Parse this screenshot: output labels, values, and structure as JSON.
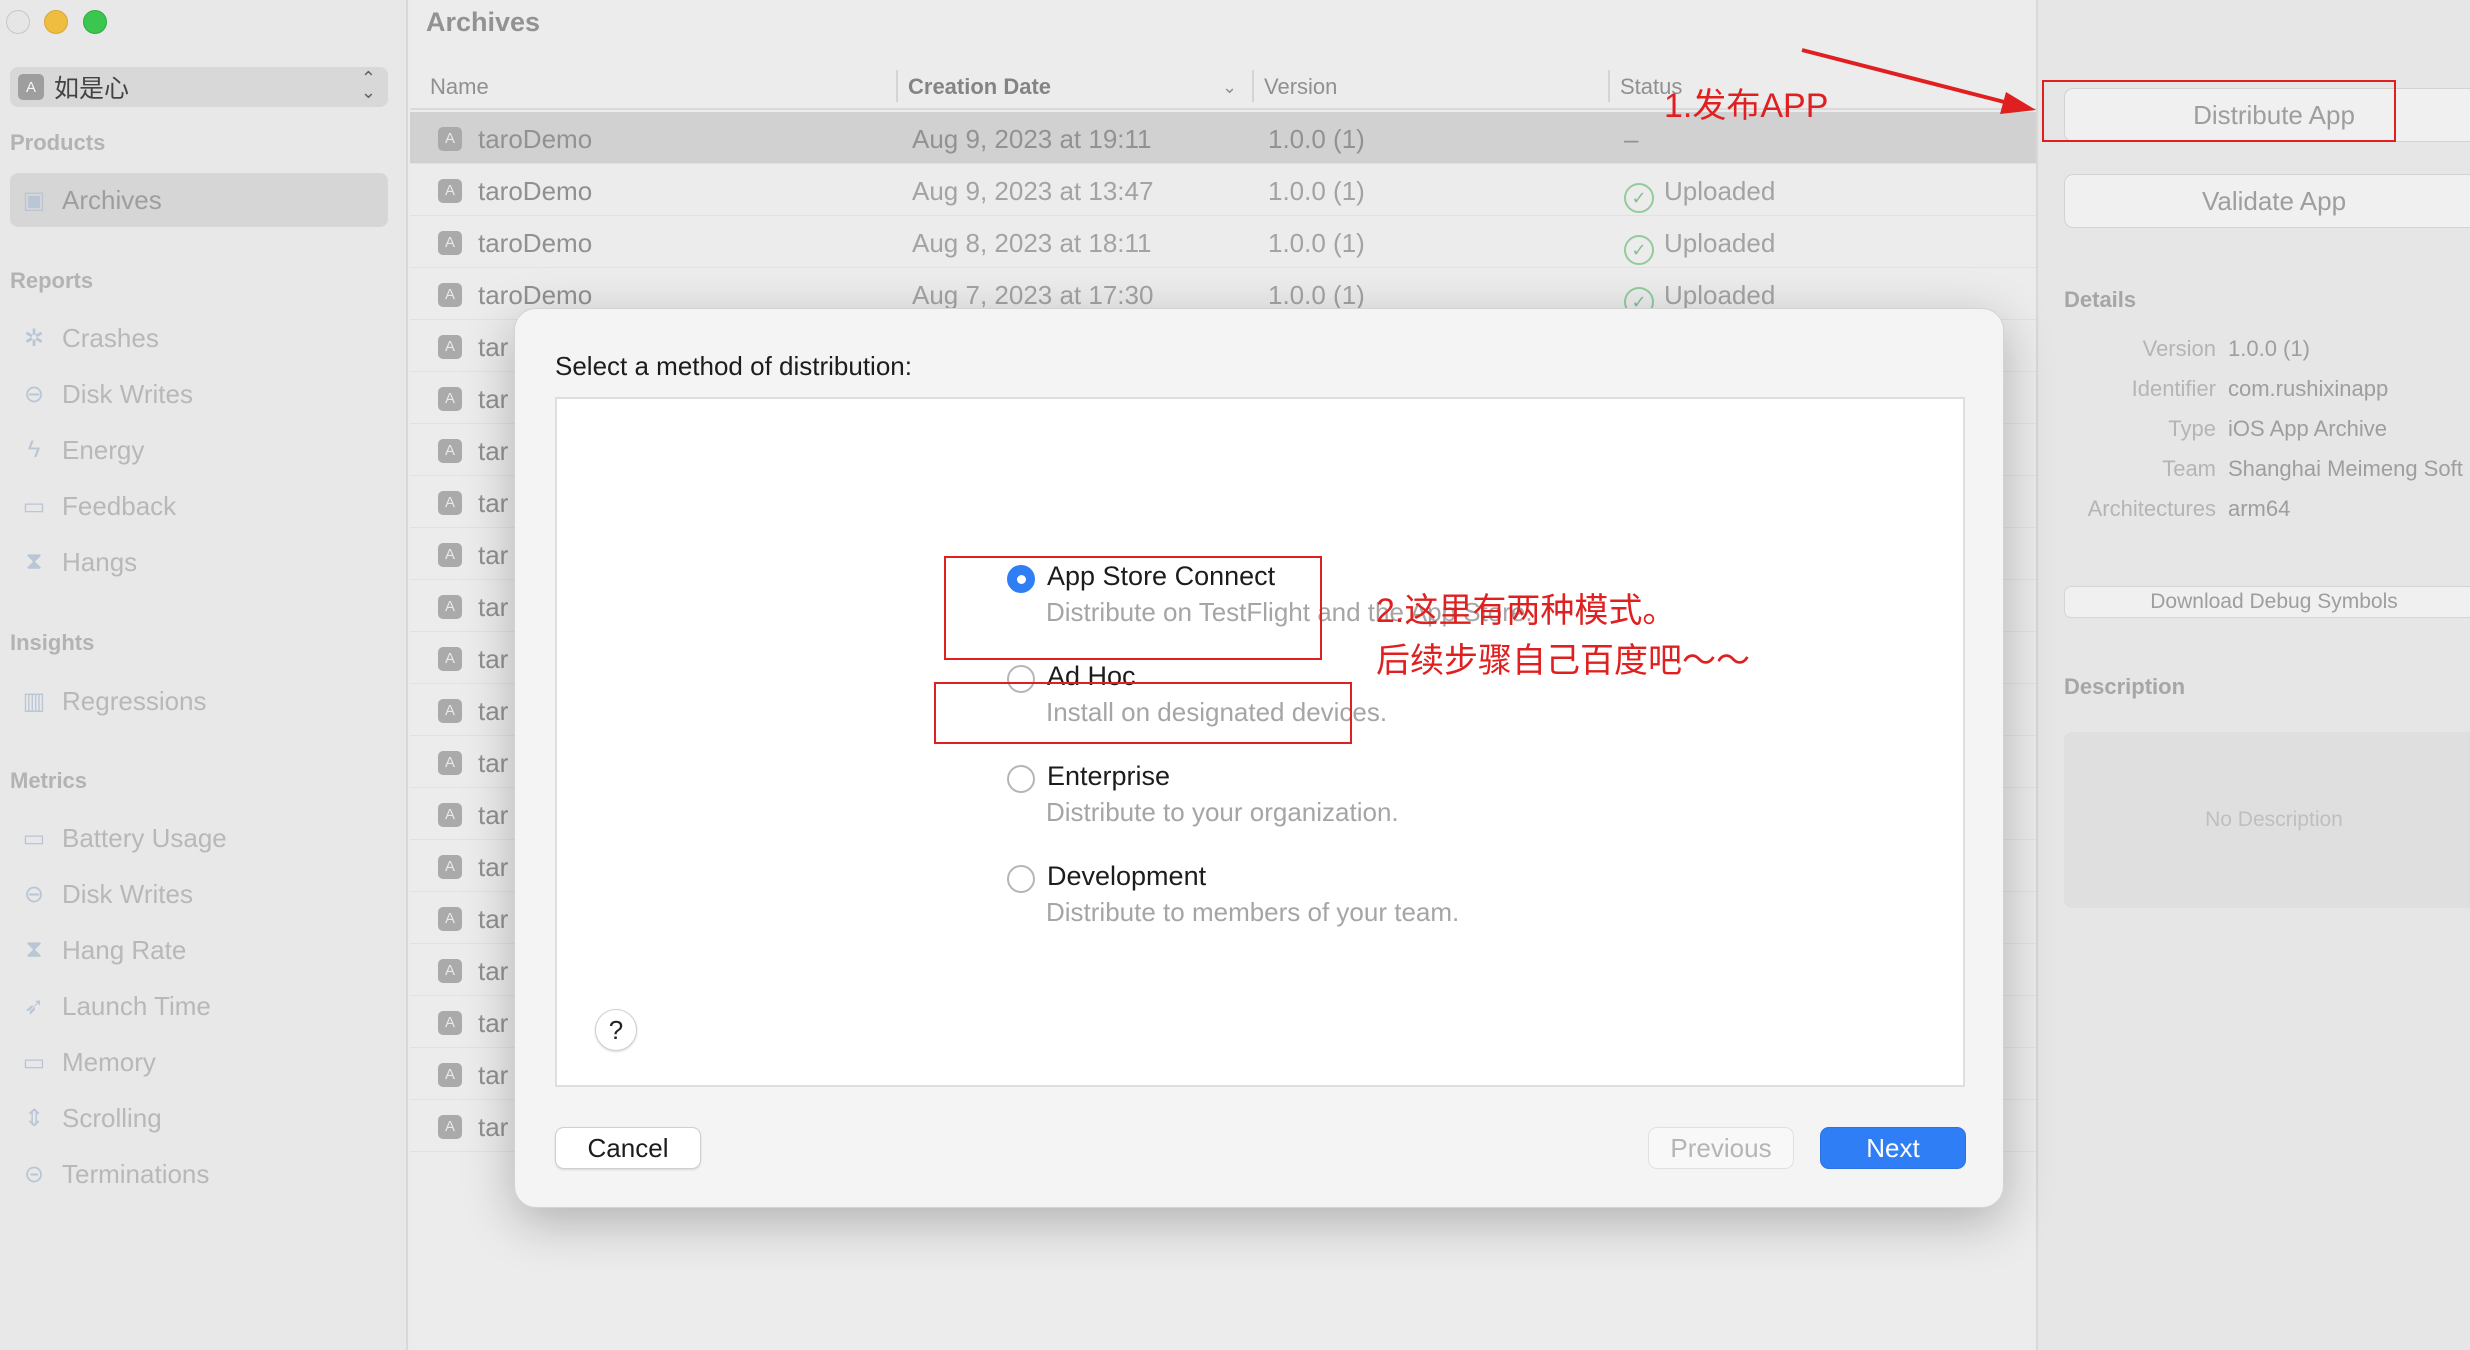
{
  "window": {
    "title": "Archives"
  },
  "sidebar": {
    "org_name": "如是心",
    "sections": [
      {
        "title": "Products",
        "items": [
          {
            "label": "Archives",
            "icon": "archive-icon",
            "selected": true
          }
        ]
      },
      {
        "title": "Reports",
        "items": [
          {
            "label": "Crashes",
            "icon": "gear-icon"
          },
          {
            "label": "Disk Writes",
            "icon": "disk-icon"
          },
          {
            "label": "Energy",
            "icon": "bolt-icon"
          },
          {
            "label": "Feedback",
            "icon": "speech-bubble-icon"
          },
          {
            "label": "Hangs",
            "icon": "hourglass-icon"
          }
        ]
      },
      {
        "title": "Insights",
        "items": [
          {
            "label": "Regressions",
            "icon": "bar-chart-icon"
          }
        ]
      },
      {
        "title": "Metrics",
        "items": [
          {
            "label": "Battery Usage",
            "icon": "battery-icon"
          },
          {
            "label": "Disk Writes",
            "icon": "disk-icon"
          },
          {
            "label": "Hang Rate",
            "icon": "hourglass-icon"
          },
          {
            "label": "Launch Time",
            "icon": "rocket-icon"
          },
          {
            "label": "Memory",
            "icon": "memory-icon"
          },
          {
            "label": "Scrolling",
            "icon": "scroll-icon"
          },
          {
            "label": "Terminations",
            "icon": "minus-circle-icon"
          }
        ]
      }
    ]
  },
  "table": {
    "columns": {
      "name": "Name",
      "date": "Creation Date",
      "version": "Version",
      "status": "Status"
    },
    "rows": [
      {
        "name": "taroDemo",
        "date": "Aug 9, 2023 at 19:11",
        "version": "1.0.0 (1)",
        "status": "–",
        "uploaded": false,
        "selected": true
      },
      {
        "name": "taroDemo",
        "date": "Aug 9, 2023 at 13:47",
        "version": "1.0.0 (1)",
        "status": "Uploaded",
        "uploaded": true
      },
      {
        "name": "taroDemo",
        "date": "Aug 8, 2023 at 18:11",
        "version": "1.0.0 (1)",
        "status": "Uploaded",
        "uploaded": true
      },
      {
        "name": "taroDemo",
        "date": "Aug 7, 2023 at 17:30",
        "version": "1.0.0 (1)",
        "status": "Uploaded",
        "uploaded": true
      },
      {
        "name": "tar"
      },
      {
        "name": "tar"
      },
      {
        "name": "tar"
      },
      {
        "name": "tar"
      },
      {
        "name": "tar"
      },
      {
        "name": "tar"
      },
      {
        "name": "tar"
      },
      {
        "name": "tar"
      },
      {
        "name": "tar"
      },
      {
        "name": "tar"
      },
      {
        "name": "tar"
      },
      {
        "name": "tar"
      },
      {
        "name": "tar"
      },
      {
        "name": "tar"
      },
      {
        "name": "tar"
      },
      {
        "name": "tar"
      }
    ]
  },
  "inspector": {
    "distribute_label": "Distribute App",
    "validate_label": "Validate App",
    "details_title": "Details",
    "details": [
      {
        "key": "Version",
        "value": "1.0.0 (1)"
      },
      {
        "key": "Identifier",
        "value": "com.rushixinapp"
      },
      {
        "key": "Type",
        "value": "iOS App Archive"
      },
      {
        "key": "Team",
        "value": "Shanghai Meimeng Soft"
      },
      {
        "key": "Architectures",
        "value": "arm64"
      }
    ],
    "debug_symbols_label": "Download Debug Symbols",
    "description_title": "Description",
    "description_placeholder": "No Description"
  },
  "dialog": {
    "title": "Select a method of distribution:",
    "options": [
      {
        "title": "App Store Connect",
        "desc": "Distribute on TestFlight and the App Store.",
        "selected": true
      },
      {
        "title": "Ad Hoc",
        "desc": "Install on designated devices.",
        "selected": false
      },
      {
        "title": "Enterprise",
        "desc": "Distribute to your organization.",
        "selected": false
      },
      {
        "title": "Development",
        "desc": "Distribute to members of your team.",
        "selected": false
      }
    ],
    "help_label": "?",
    "cancel_label": "Cancel",
    "previous_label": "Previous",
    "next_label": "Next"
  },
  "annotations": {
    "step1": "1.发布APP",
    "step2_line1": "2.这里有两种模式。",
    "step2_line2": "后续步骤自己百度吧～～",
    "color": "#e02020"
  },
  "colors": {
    "accent": "#2f7ef5",
    "uploaded": "#7ac189"
  }
}
